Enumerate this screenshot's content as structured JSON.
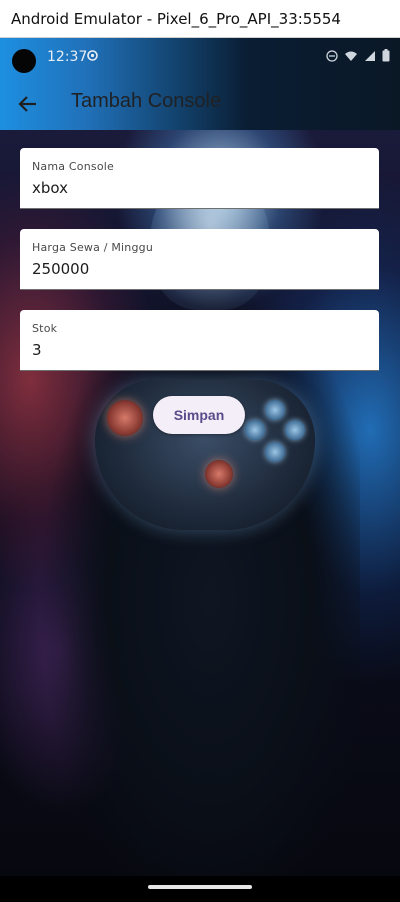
{
  "window": {
    "title": "Android Emulator - Pixel_6_Pro_API_33:5554"
  },
  "statusbar": {
    "time": "12:37",
    "icons": [
      "camera-cutout",
      "gear-icon",
      "dnd-icon",
      "wifi-icon",
      "signal-icon",
      "battery-icon"
    ]
  },
  "appbar": {
    "title": "Tambah Console",
    "back_icon": "arrow-back-icon",
    "background_gradient": [
      "#1e8fe0",
      "#0a1826"
    ]
  },
  "form": {
    "fields": [
      {
        "label": "Nama Console",
        "value": "xbox"
      },
      {
        "label": "Harga Sewa / Minggu",
        "value": "250000"
      },
      {
        "label": "Stok",
        "value": "3"
      }
    ],
    "submit_label": "Simpan"
  },
  "colors": {
    "button_bg": "#f4eef8",
    "button_text": "#5b4b8a",
    "field_bg": "#ffffff"
  }
}
